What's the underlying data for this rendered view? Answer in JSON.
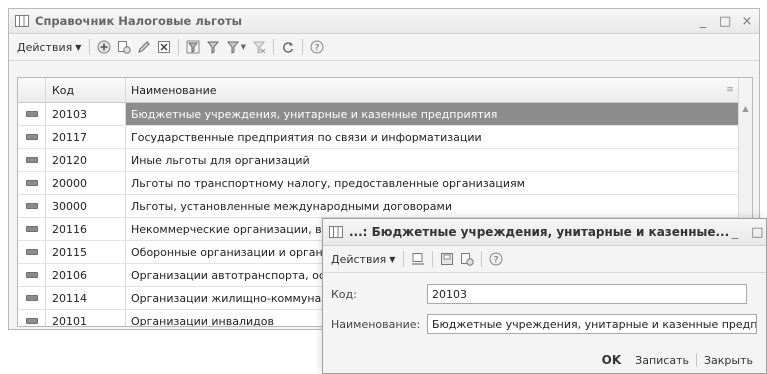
{
  "main_window": {
    "title": "Справочник Налоговые льготы",
    "controls": {
      "minimize": "_",
      "maximize": "□",
      "close": "×"
    },
    "toolbar": {
      "actions_label": "Действия",
      "icons": [
        "add-icon",
        "copy-icon",
        "edit-icon",
        "delete-icon",
        "filter-icon",
        "filter-by-value-icon",
        "filter-dropdown-icon",
        "clear-filter-icon",
        "refresh-icon",
        "help-icon"
      ]
    },
    "table": {
      "headers": {
        "code": "Код",
        "name": "Наименование"
      },
      "rows": [
        {
          "code": "20103",
          "name": "Бюджетные учреждения, унитарные и казенные предприятия",
          "selected": true
        },
        {
          "code": "20117",
          "name": "Государственные предприятия по связи и информатизации"
        },
        {
          "code": "20120",
          "name": "Иные льготы для организаций"
        },
        {
          "code": "20000",
          "name": "Льготы по транспортному налогу, предоставленные организациям"
        },
        {
          "code": "30000",
          "name": "Льготы, установленные международными договорами"
        },
        {
          "code": "20116",
          "name": "Некоммерческие организации, в том"
        },
        {
          "code": "20115",
          "name": "Оборонные организации и организаци"
        },
        {
          "code": "20106",
          "name": "Организации автотранспорта, осуще"
        },
        {
          "code": "20114",
          "name": "Организации жилищно-коммунально"
        },
        {
          "code": "20101",
          "name": "Организации инвалидов"
        }
      ]
    }
  },
  "dialog": {
    "title": "...: Бюджетные учреждения, унитарные и казенные...",
    "controls": {
      "minimize": "_",
      "maximize": "□",
      "close": "×"
    },
    "toolbar": {
      "actions_label": "Действия",
      "icons": [
        "save-close-icon",
        "save-icon",
        "copy-icon",
        "help-icon"
      ]
    },
    "fields": {
      "code_label": "Код:",
      "code_value": "20103",
      "name_label": "Наименование:",
      "name_value": "Бюджетные учреждения, унитарные и казенные предприя"
    },
    "buttons": {
      "ok": "OK",
      "save": "Записать",
      "close": "Закрыть"
    }
  }
}
